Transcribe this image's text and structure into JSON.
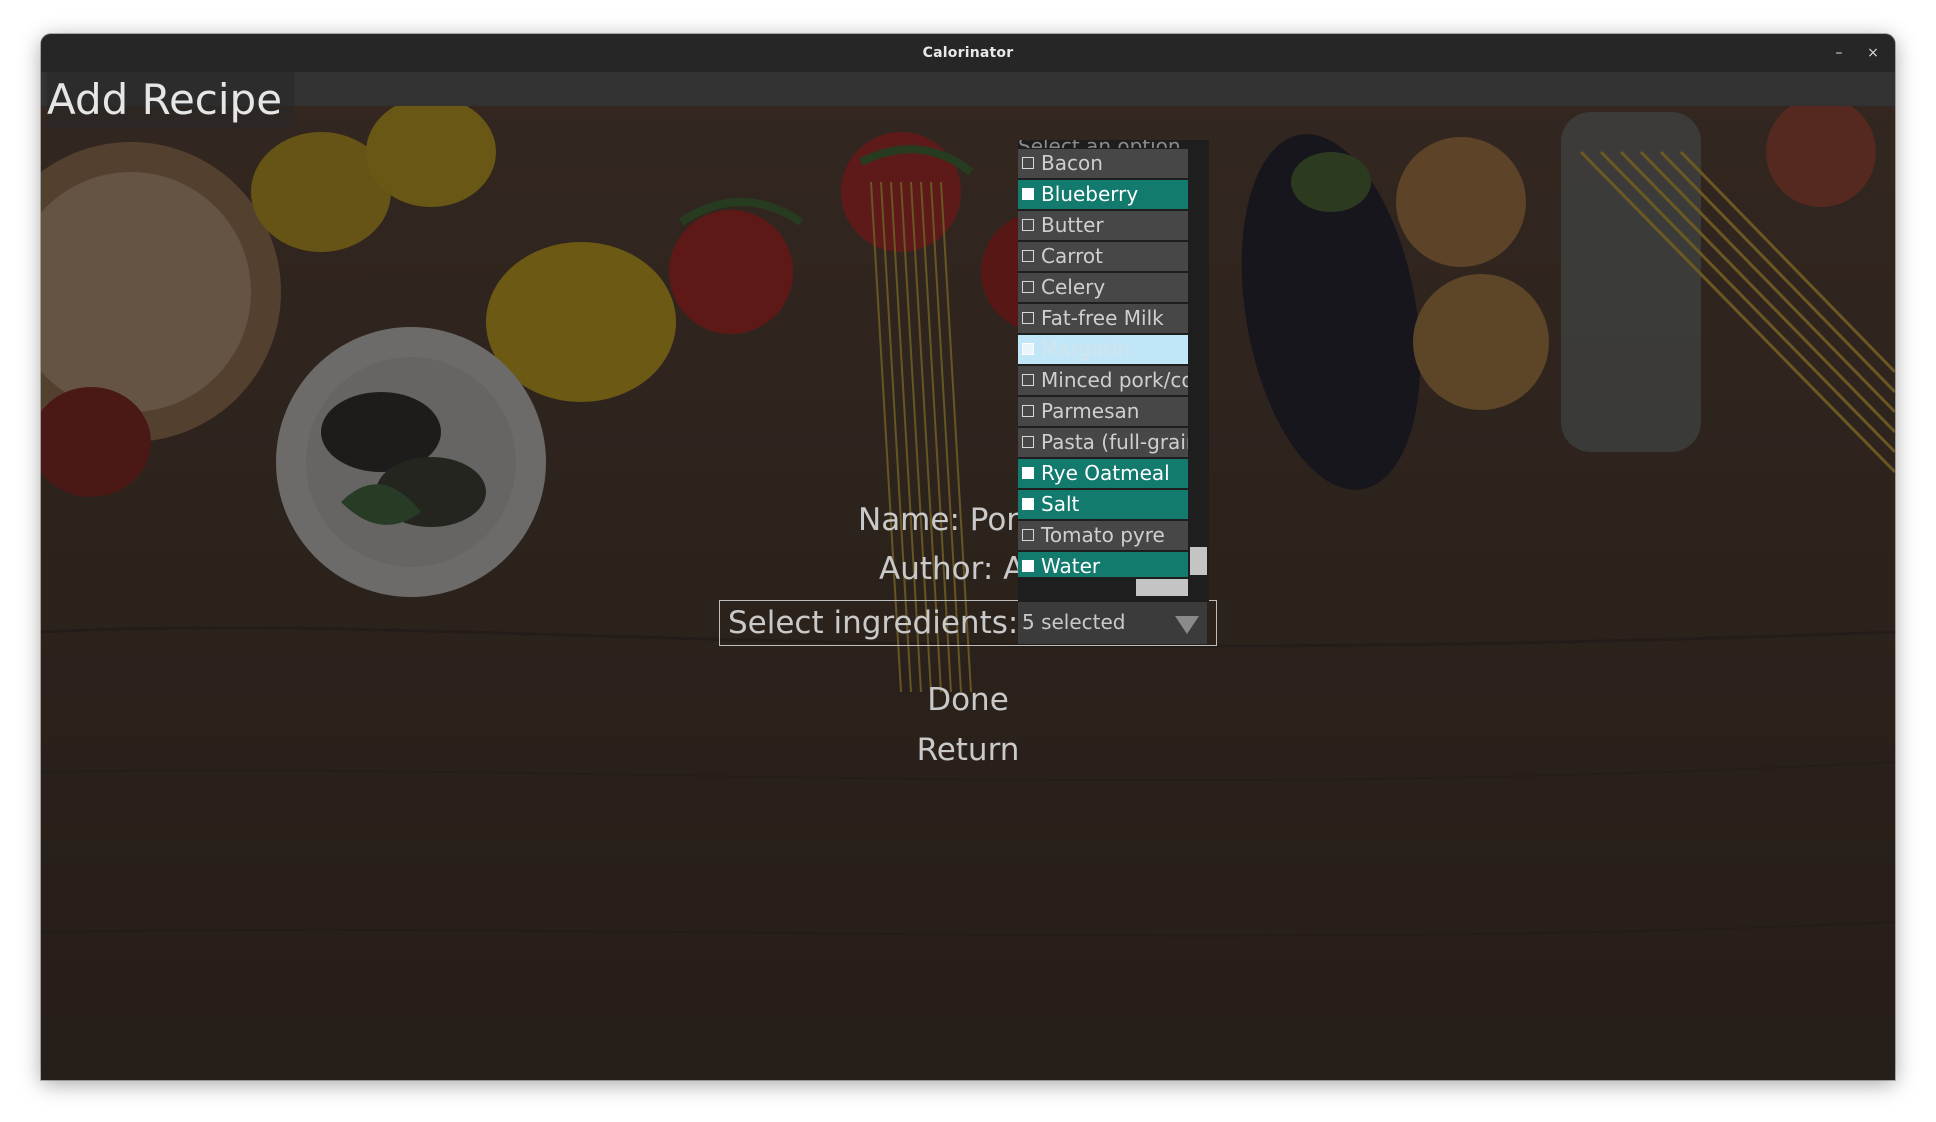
{
  "window": {
    "title": "Calorinator",
    "minimize_glyph": "–",
    "close_glyph": "×"
  },
  "page": {
    "title": "Add Recipe"
  },
  "form": {
    "name_label": "Name: Porr",
    "author_label": "Author: Al",
    "ingredients_label": "Select ingredients:",
    "ingredients_value": "5 selected",
    "done_label": "Done",
    "return_label": "Return"
  },
  "dropdown": {
    "header_partial": "Select an option",
    "items": [
      {
        "label": "Bacon",
        "selected": false
      },
      {
        "label": "Blueberry",
        "selected": true
      },
      {
        "label": "Butter",
        "selected": false
      },
      {
        "label": "Carrot",
        "selected": false
      },
      {
        "label": "Celery",
        "selected": false
      },
      {
        "label": "Fat-free Milk",
        "selected": false
      },
      {
        "label": "Margarin",
        "selected": false,
        "hovered": true
      },
      {
        "label": "Minced pork/co",
        "selected": false
      },
      {
        "label": "Parmesan",
        "selected": false
      },
      {
        "label": "Pasta (full-grain)",
        "selected": false
      },
      {
        "label": "Rye Oatmeal",
        "selected": true
      },
      {
        "label": "Salt",
        "selected": true
      },
      {
        "label": "Tomato pyre",
        "selected": false
      },
      {
        "label": "Water",
        "selected": true
      }
    ]
  },
  "colors": {
    "selected_item": "#137a6e",
    "hover_item": "#c0e6f7",
    "titlebar": "#262626"
  }
}
